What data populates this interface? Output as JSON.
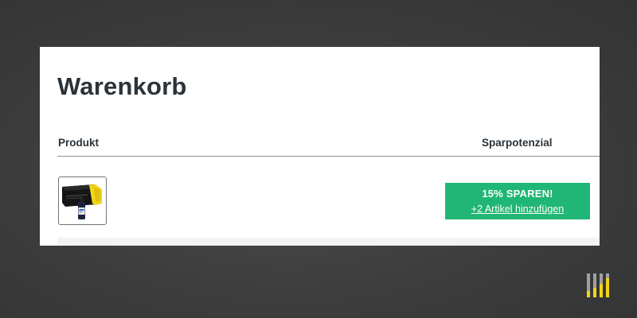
{
  "cart": {
    "title": "Warenkorb",
    "columns": {
      "product": "Produkt",
      "savings": "Sparpotenzial"
    },
    "items": [
      {
        "image_icon": "toner-cartridge-and-ink-bottle-image",
        "savings_badge": "15% SPAREN!",
        "savings_action": "+2 Artikel hinzufügen"
      }
    ]
  },
  "colors": {
    "background": "#3c3c3c",
    "card": "#ffffff",
    "text": "#2b333a",
    "savings_green": "#20b675",
    "logo_yellow": "#f2d51b",
    "logo_gray": "#a0a0a0"
  },
  "logo": {
    "icon": "bar-chart-brand-logo-icon"
  }
}
